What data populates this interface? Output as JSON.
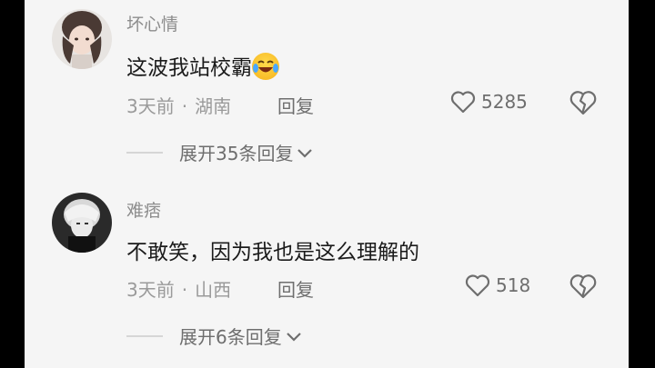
{
  "comments": [
    {
      "username": "坏心情",
      "text": "这波我站校霸",
      "time": "3天前",
      "separator": "·",
      "location": "湖南",
      "reply_label": "回复",
      "likes": "5285",
      "expand_label": "展开35条回复"
    },
    {
      "username": "难痞",
      "text": "不敢笑，因为我也是这么理解的",
      "time": "3天前",
      "separator": "·",
      "location": "山西",
      "reply_label": "回复",
      "likes": "518",
      "expand_label": "展开6条回复"
    }
  ],
  "icons": {
    "emoji": "laughing-crying-emoji",
    "like": "heart-outline-icon",
    "dislike": "broken-heart-icon",
    "expand": "chevron-down-icon"
  },
  "colors": {
    "background": "#f5f5f5",
    "text": "#1b1b1b",
    "meta": "#9a9a9a",
    "accent_emoji": "#f6b21c"
  }
}
